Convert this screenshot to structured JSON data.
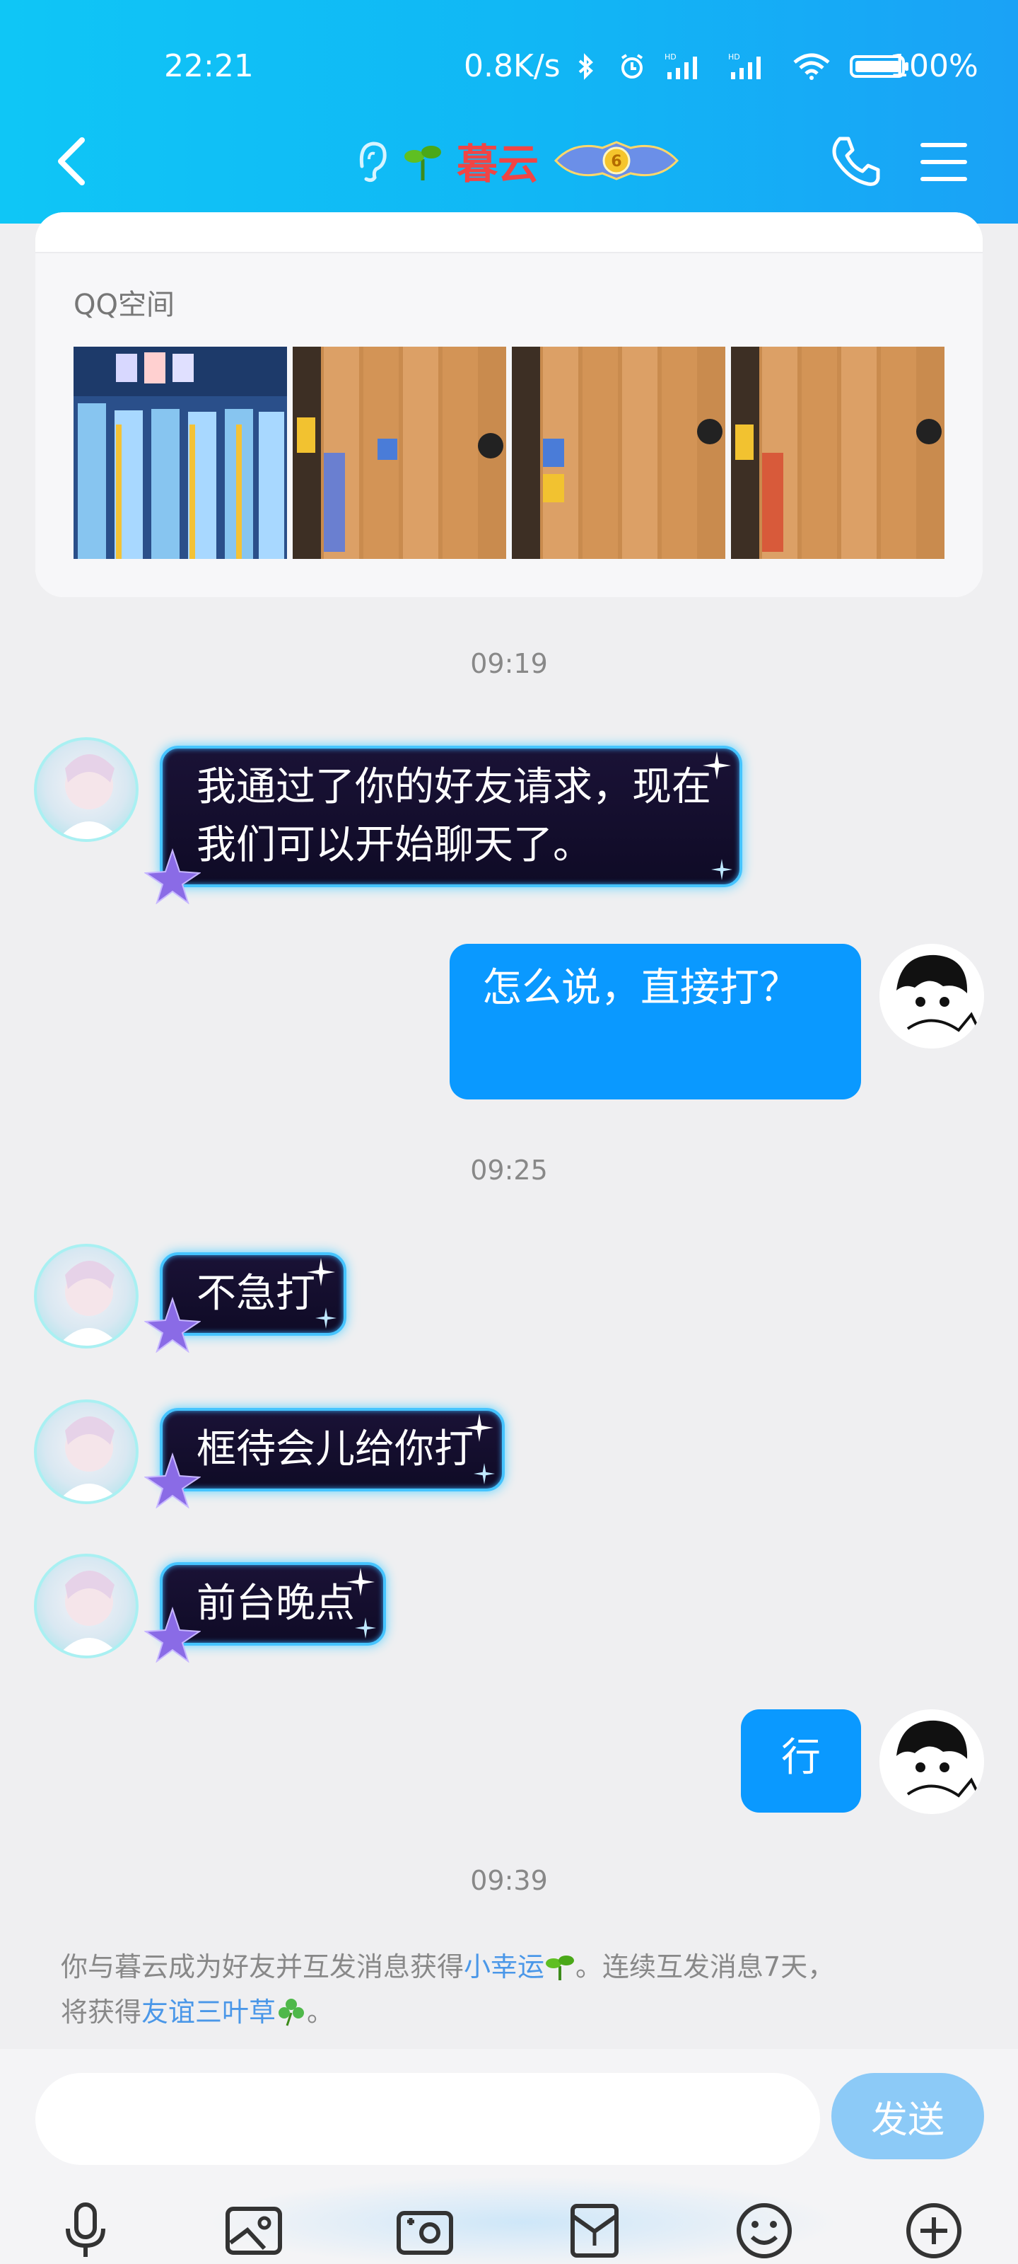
{
  "status_bar": {
    "time": "22:21",
    "network_speed": "0.8K/s",
    "battery": "100%",
    "icons": [
      "bluetooth-icon",
      "alarm-icon",
      "signal-hd-icon",
      "signal-hd-icon",
      "wifi-icon",
      "battery-icon"
    ]
  },
  "header": {
    "contact_name": "暮云",
    "level_badge": "6",
    "colors": {
      "gradient_start": "#0fc6f6",
      "gradient_end": "#1aa2f6",
      "name_color": "#f04545"
    }
  },
  "qzone": {
    "label": "QQ空间",
    "photos": [
      "photo-1",
      "photo-2",
      "photo-3",
      "photo-4"
    ]
  },
  "messages": {
    "time1": "09:19",
    "m1": {
      "side": "left",
      "line1": "我通过了你的好友请求，现在",
      "line2": "我们可以开始聊天了。"
    },
    "m2": {
      "side": "right",
      "text": "怎么说，直接打？"
    },
    "time2": "09:25",
    "m3": {
      "side": "left",
      "text": "不急打"
    },
    "m4": {
      "side": "left",
      "text": "框待会儿给你打"
    },
    "m5": {
      "side": "left",
      "text": "前台晚点"
    },
    "m6": {
      "side": "right",
      "text": "行"
    },
    "time3": "09:39"
  },
  "notice": {
    "part1": "你与暮云成为好友并互发消息获得",
    "link1": "小幸运",
    "part2": "。连续互发消息7天，",
    "part3": "将获得",
    "link2": "友谊三叶草",
    "part4": "。"
  },
  "input": {
    "placeholder": "",
    "send_label": "发送"
  },
  "toolbar": [
    "microphone-icon",
    "image-icon",
    "camera-icon",
    "red-packet-icon",
    "emoji-icon",
    "plus-icon"
  ]
}
